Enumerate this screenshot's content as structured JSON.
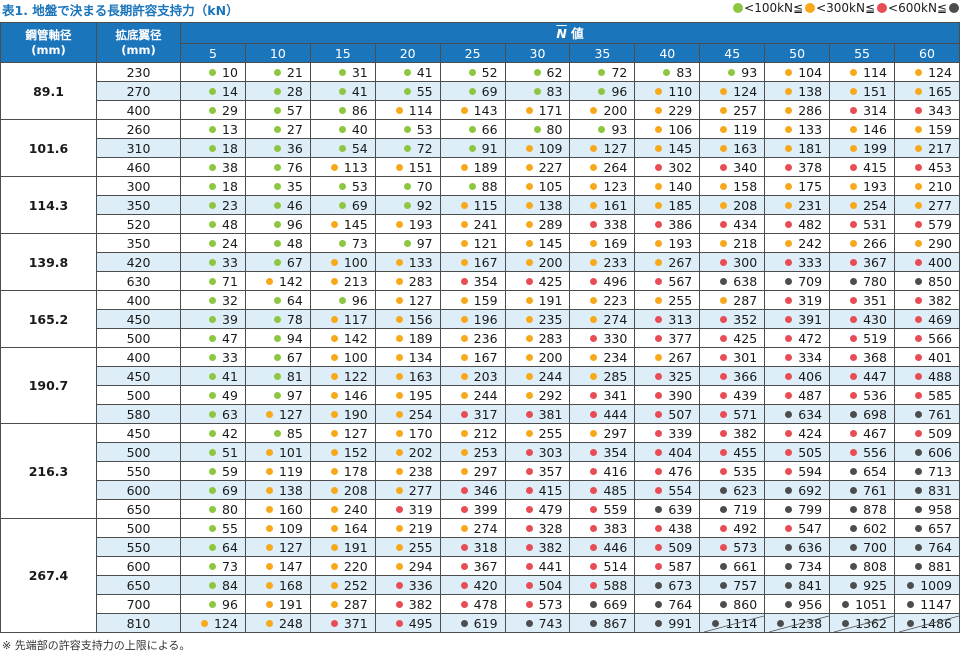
{
  "title": "表1. 地盤で決まる長期許容支持力（kN）",
  "legend": {
    "items": [
      {
        "color": "#8dc63f",
        "text": "<100kN≦"
      },
      {
        "color": "#f7a81b",
        "text": "<300kN≦"
      },
      {
        "color": "#e84c55",
        "text": "<600kN≦"
      },
      {
        "color": "#4d4d4d",
        "text": ""
      }
    ]
  },
  "colors": {
    "green": "#8dc63f",
    "orange": "#f7a81b",
    "red": "#e84c55",
    "gray": "#4d4d4d",
    "header": "#1b75bb",
    "stripe": "#ddeef9"
  },
  "header": {
    "pipe_diameter": "鋼管軸径",
    "pipe_unit": "(mm)",
    "bulb_diameter": "拡底翼径",
    "bulb_unit": "(mm)",
    "n_value_symbol": "N",
    "n_value_label": "値",
    "n_columns": [
      "5",
      "10",
      "15",
      "20",
      "25",
      "30",
      "35",
      "40",
      "45",
      "50",
      "55",
      "60"
    ]
  },
  "groups": [
    {
      "pipe": "89.1",
      "rows": [
        {
          "bulb": "230",
          "values": [
            10,
            21,
            31,
            41,
            52,
            62,
            72,
            83,
            93,
            104,
            114,
            124
          ]
        },
        {
          "bulb": "270",
          "values": [
            14,
            28,
            41,
            55,
            69,
            83,
            96,
            110,
            124,
            138,
            151,
            165
          ]
        },
        {
          "bulb": "400",
          "values": [
            29,
            57,
            86,
            114,
            143,
            171,
            200,
            229,
            257,
            286,
            314,
            343
          ]
        }
      ]
    },
    {
      "pipe": "101.6",
      "rows": [
        {
          "bulb": "260",
          "values": [
            13,
            27,
            40,
            53,
            66,
            80,
            93,
            106,
            119,
            133,
            146,
            159
          ]
        },
        {
          "bulb": "310",
          "values": [
            18,
            36,
            54,
            72,
            91,
            109,
            127,
            145,
            163,
            181,
            199,
            217
          ]
        },
        {
          "bulb": "460",
          "values": [
            38,
            76,
            113,
            151,
            189,
            227,
            264,
            302,
            340,
            378,
            415,
            453
          ]
        }
      ]
    },
    {
      "pipe": "114.3",
      "rows": [
        {
          "bulb": "300",
          "values": [
            18,
            35,
            53,
            70,
            88,
            105,
            123,
            140,
            158,
            175,
            193,
            210
          ]
        },
        {
          "bulb": "350",
          "values": [
            23,
            46,
            69,
            92,
            115,
            138,
            161,
            185,
            208,
            231,
            254,
            277
          ]
        },
        {
          "bulb": "520",
          "values": [
            48,
            96,
            145,
            193,
            241,
            289,
            338,
            386,
            434,
            482,
            531,
            579
          ]
        }
      ]
    },
    {
      "pipe": "139.8",
      "rows": [
        {
          "bulb": "350",
          "values": [
            24,
            48,
            73,
            97,
            121,
            145,
            169,
            193,
            218,
            242,
            266,
            290
          ]
        },
        {
          "bulb": "420",
          "values": [
            33,
            67,
            100,
            133,
            167,
            200,
            233,
            267,
            300,
            333,
            367,
            400
          ]
        },
        {
          "bulb": "630",
          "values": [
            71,
            142,
            213,
            283,
            354,
            425,
            496,
            567,
            638,
            709,
            780,
            850
          ]
        }
      ]
    },
    {
      "pipe": "165.2",
      "rows": [
        {
          "bulb": "400",
          "values": [
            32,
            64,
            96,
            127,
            159,
            191,
            223,
            255,
            287,
            319,
            351,
            382
          ]
        },
        {
          "bulb": "450",
          "values": [
            39,
            78,
            117,
            156,
            196,
            235,
            274,
            313,
            352,
            391,
            430,
            469
          ]
        },
        {
          "bulb": "500",
          "values": [
            47,
            94,
            142,
            189,
            236,
            283,
            330,
            377,
            425,
            472,
            519,
            566
          ]
        }
      ]
    },
    {
      "pipe": "190.7",
      "rows": [
        {
          "bulb": "400",
          "values": [
            33,
            67,
            100,
            134,
            167,
            200,
            234,
            267,
            301,
            334,
            368,
            401
          ]
        },
        {
          "bulb": "450",
          "values": [
            41,
            81,
            122,
            163,
            203,
            244,
            285,
            325,
            366,
            406,
            447,
            488
          ]
        },
        {
          "bulb": "500",
          "values": [
            49,
            97,
            146,
            195,
            244,
            292,
            341,
            390,
            439,
            487,
            536,
            585
          ]
        },
        {
          "bulb": "580",
          "values": [
            63,
            127,
            190,
            254,
            317,
            381,
            444,
            507,
            571,
            634,
            698,
            761
          ]
        }
      ]
    },
    {
      "pipe": "216.3",
      "rows": [
        {
          "bulb": "450",
          "values": [
            42,
            85,
            127,
            170,
            212,
            255,
            297,
            339,
            382,
            424,
            467,
            509
          ]
        },
        {
          "bulb": "500",
          "values": [
            51,
            101,
            152,
            202,
            253,
            303,
            354,
            404,
            455,
            505,
            556,
            606
          ]
        },
        {
          "bulb": "550",
          "values": [
            59,
            119,
            178,
            238,
            297,
            357,
            416,
            476,
            535,
            594,
            654,
            713
          ]
        },
        {
          "bulb": "600",
          "values": [
            69,
            138,
            208,
            277,
            346,
            415,
            485,
            554,
            623,
            692,
            761,
            831
          ]
        },
        {
          "bulb": "650",
          "values": [
            80,
            160,
            240,
            319,
            399,
            479,
            559,
            639,
            719,
            799,
            878,
            958
          ]
        }
      ]
    },
    {
      "pipe": "267.4",
      "rows": [
        {
          "bulb": "500",
          "values": [
            55,
            109,
            164,
            219,
            274,
            328,
            383,
            438,
            492,
            547,
            602,
            657
          ]
        },
        {
          "bulb": "550",
          "values": [
            64,
            127,
            191,
            255,
            318,
            382,
            446,
            509,
            573,
            636,
            700,
            764
          ]
        },
        {
          "bulb": "600",
          "values": [
            73,
            147,
            220,
            294,
            367,
            441,
            514,
            587,
            661,
            734,
            808,
            881
          ]
        },
        {
          "bulb": "650",
          "values": [
            84,
            168,
            252,
            336,
            420,
            504,
            588,
            673,
            757,
            841,
            925,
            1009
          ]
        },
        {
          "bulb": "700",
          "values": [
            96,
            191,
            287,
            382,
            478,
            573,
            669,
            764,
            860,
            956,
            1051,
            1147
          ]
        },
        {
          "bulb": "810",
          "values": [
            124,
            248,
            371,
            495,
            619,
            743,
            867,
            991,
            1114,
            1238,
            1362,
            1486
          ],
          "capped_from_index": 8
        }
      ]
    }
  ],
  "footnote": "※ 先端部の許容支持力の上限による。"
}
